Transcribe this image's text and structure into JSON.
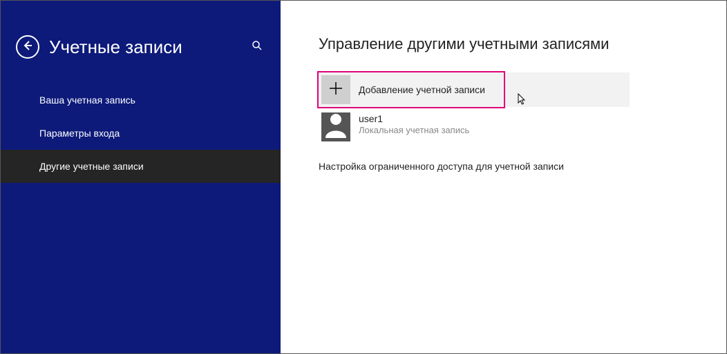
{
  "sidebar": {
    "title": "Учетные записи",
    "items": [
      {
        "label": "Ваша учетная запись"
      },
      {
        "label": "Параметры входа"
      },
      {
        "label": "Другие учетные записи"
      }
    ]
  },
  "main": {
    "title": "Управление другими учетными записями",
    "add_account_label": "Добавление учетной записи",
    "account": {
      "name": "user1",
      "type": "Локальная учетная запись"
    },
    "restricted_link": "Настройка ограниченного доступа для учетной записи"
  }
}
